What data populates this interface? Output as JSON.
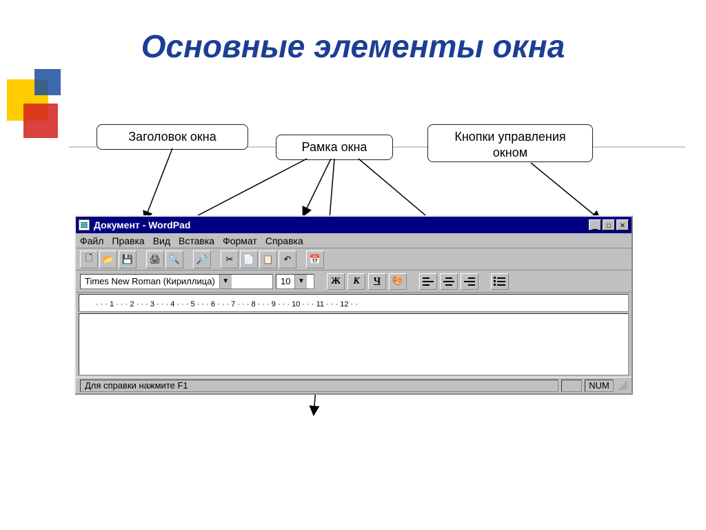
{
  "slide": {
    "title": "Основные элементы окна",
    "labels": {
      "title_label": "Заголовок окна",
      "frame_label": "Рамка окна",
      "controls_label": "Кнопки управления окном"
    }
  },
  "wordpad": {
    "title": "Документ - WordPad",
    "window_buttons": {
      "min": "_",
      "max": "☐",
      "close": "✕"
    },
    "menu": {
      "file": "Файл",
      "edit": "Правка",
      "view": "Вид",
      "insert": "Вставка",
      "format": "Формат",
      "help": "Справка"
    },
    "toolbar_icons": {
      "new": "🗋",
      "open": "📂",
      "save": "💾",
      "print": "🖨",
      "preview": "🔍",
      "find": "🔎",
      "cut": "✂",
      "copy": "📄",
      "paste": "📋",
      "undo": "↶",
      "datetime": "📅"
    },
    "format": {
      "font": "Times New Roman (Кириллица)",
      "size": "10",
      "bold": "Ж",
      "italic": "К",
      "underline": "Ч",
      "color": "🎨"
    },
    "ruler": "· · · 1 · · · 2 · · · 3 · · · 4 · · · 5 · · · 6 · · · 7 · · · 8 · · · 9 · · · 10 · · · 11 · · · 12 · ·",
    "status": {
      "help": "Для справки нажмите F1",
      "num": "NUM"
    }
  }
}
